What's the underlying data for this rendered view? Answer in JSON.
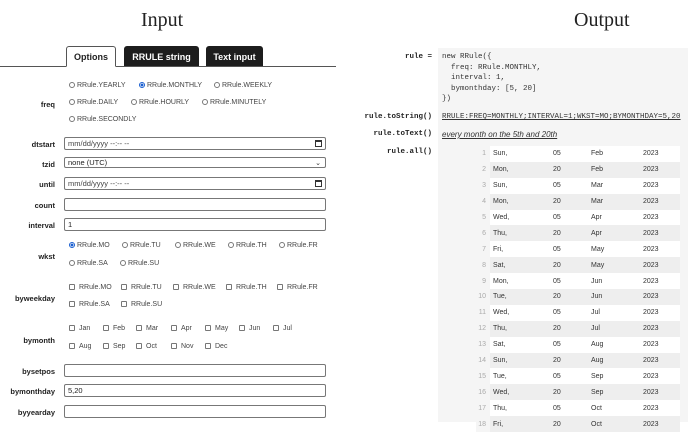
{
  "headings": {
    "input": "Input",
    "output": "Output"
  },
  "tabs": [
    "Options",
    "RRULE string",
    "Text input"
  ],
  "labels": {
    "freq": "freq",
    "dtstart": "dtstart",
    "tzid": "tzid",
    "until": "until",
    "count": "count",
    "interval": "interval",
    "wkst": "wkst",
    "byweekday": "byweekday",
    "bymonth": "bymonth",
    "bysetpos": "bysetpos",
    "bymonthday": "bymonthday",
    "byyearday": "byyearday"
  },
  "freq_options": [
    "RRule.YEARLY",
    "RRule.MONTHLY",
    "RRule.WEEKLY",
    "RRule.DAILY",
    "RRule.HOURLY",
    "RRule.MINUTELY",
    "RRule.SECONDLY"
  ],
  "freq_selected": "RRule.MONTHLY",
  "dtstart_placeholder": "mm/dd/yyyy --:-- --",
  "tzid_value": "none (UTC)",
  "until_placeholder": "mm/dd/yyyy --:-- --",
  "count_value": "",
  "interval_value": "1",
  "wkst_options": [
    "RRule.MO",
    "RRule.TU",
    "RRule.WE",
    "RRule.TH",
    "RRule.FR",
    "RRule.SA",
    "RRule.SU"
  ],
  "wkst_selected": "RRule.MO",
  "byweekday_options": [
    "RRule.MO",
    "RRule.TU",
    "RRule.WE",
    "RRule.TH",
    "RRule.FR",
    "RRule.SA",
    "RRule.SU"
  ],
  "bymonth_options": [
    "Jan",
    "Feb",
    "Mar",
    "Apr",
    "May",
    "Jun",
    "Jul",
    "Aug",
    "Sep",
    "Oct",
    "Nov",
    "Dec"
  ],
  "bysetpos_value": "",
  "bymonthday_value": "5,20",
  "byyearday_value": "",
  "output": {
    "labels": {
      "rule": "rule =",
      "tostring": "rule.toString()",
      "totext": "rule.toText()",
      "all": "rule.all()"
    },
    "code": "new RRule({\n  freq: RRule.MONTHLY,\n  interval: 1,\n  bymonthday: [5, 20]\n})",
    "rrule_string": "RRULE:FREQ=MONTHLY;INTERVAL=1;WKST=MO;BYMONTHDAY=5,20",
    "text": "every month on the 5th and 20th",
    "dates": [
      [
        "1",
        "Sun,",
        "05",
        "Feb",
        "2023"
      ],
      [
        "2",
        "Mon,",
        "20",
        "Feb",
        "2023"
      ],
      [
        "3",
        "Sun,",
        "05",
        "Mar",
        "2023"
      ],
      [
        "4",
        "Mon,",
        "20",
        "Mar",
        "2023"
      ],
      [
        "5",
        "Wed,",
        "05",
        "Apr",
        "2023"
      ],
      [
        "6",
        "Thu,",
        "20",
        "Apr",
        "2023"
      ],
      [
        "7",
        "Fri,",
        "05",
        "May",
        "2023"
      ],
      [
        "8",
        "Sat,",
        "20",
        "May",
        "2023"
      ],
      [
        "9",
        "Mon,",
        "05",
        "Jun",
        "2023"
      ],
      [
        "10",
        "Tue,",
        "20",
        "Jun",
        "2023"
      ],
      [
        "11",
        "Wed,",
        "05",
        "Jul",
        "2023"
      ],
      [
        "12",
        "Thu,",
        "20",
        "Jul",
        "2023"
      ],
      [
        "13",
        "Sat,",
        "05",
        "Aug",
        "2023"
      ],
      [
        "14",
        "Sun,",
        "20",
        "Aug",
        "2023"
      ],
      [
        "15",
        "Tue,",
        "05",
        "Sep",
        "2023"
      ],
      [
        "16",
        "Wed,",
        "20",
        "Sep",
        "2023"
      ],
      [
        "17",
        "Thu,",
        "05",
        "Oct",
        "2023"
      ],
      [
        "18",
        "Fri,",
        "20",
        "Oct",
        "2023"
      ]
    ]
  }
}
